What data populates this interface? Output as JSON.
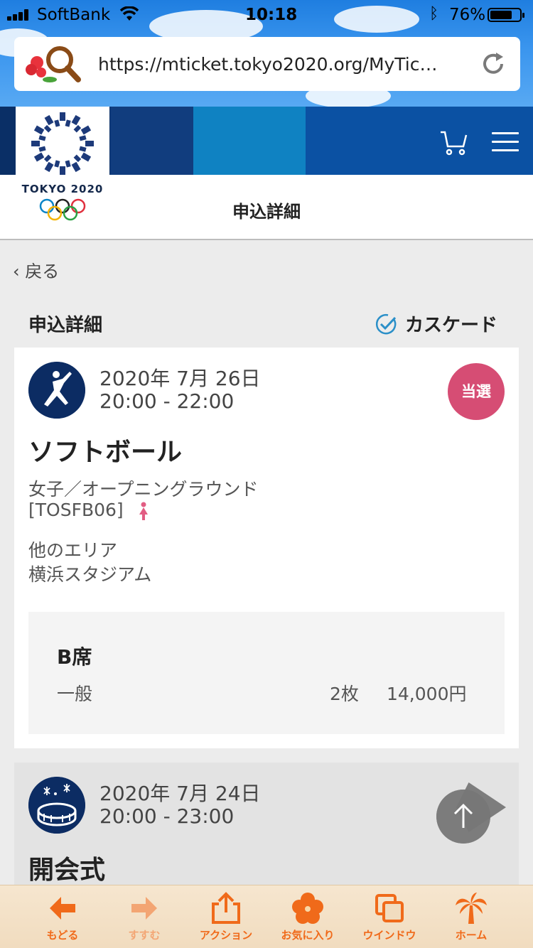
{
  "status_bar": {
    "carrier": "SoftBank",
    "time": "10:18",
    "battery_percent": "76%",
    "battery_level": 0.76
  },
  "browser": {
    "url": "https://mticket.tokyo2020.org/MyTic…"
  },
  "header": {
    "emblem_text": "TOKYO 2020",
    "page_title": "申込詳細"
  },
  "nav": {
    "back_label": "戻る"
  },
  "section": {
    "title": "申込詳細",
    "cascade_label": "カスケード"
  },
  "applications": [
    {
      "date": "2020年 7月 26日",
      "time": "20:00 - 22:00",
      "status": "当選",
      "sport": "ソフトボール",
      "event": "女子／オープニングラウンド",
      "code": "[TOSFB06]",
      "area": "他のエリア",
      "venue": "横浜スタジアム",
      "seat": {
        "category": "B席",
        "type": "一般",
        "quantity": "2枚",
        "price": "14,000円"
      },
      "icon": "softball-icon",
      "gender_icon": "female-icon"
    },
    {
      "date": "2020年 7月 24日",
      "time": "20:00 - 23:00",
      "sport": "開会式",
      "icon": "ceremony-icon"
    }
  ],
  "toolbar": {
    "back": "もどる",
    "forward": "すすむ",
    "action": "アクション",
    "favorites": "お気に入り",
    "window": "ウインドウ",
    "home": "ホーム"
  },
  "colors": {
    "accent_orange": "#f06a1a",
    "status_badge": "#d64d74",
    "navy": "#0c2c63"
  }
}
